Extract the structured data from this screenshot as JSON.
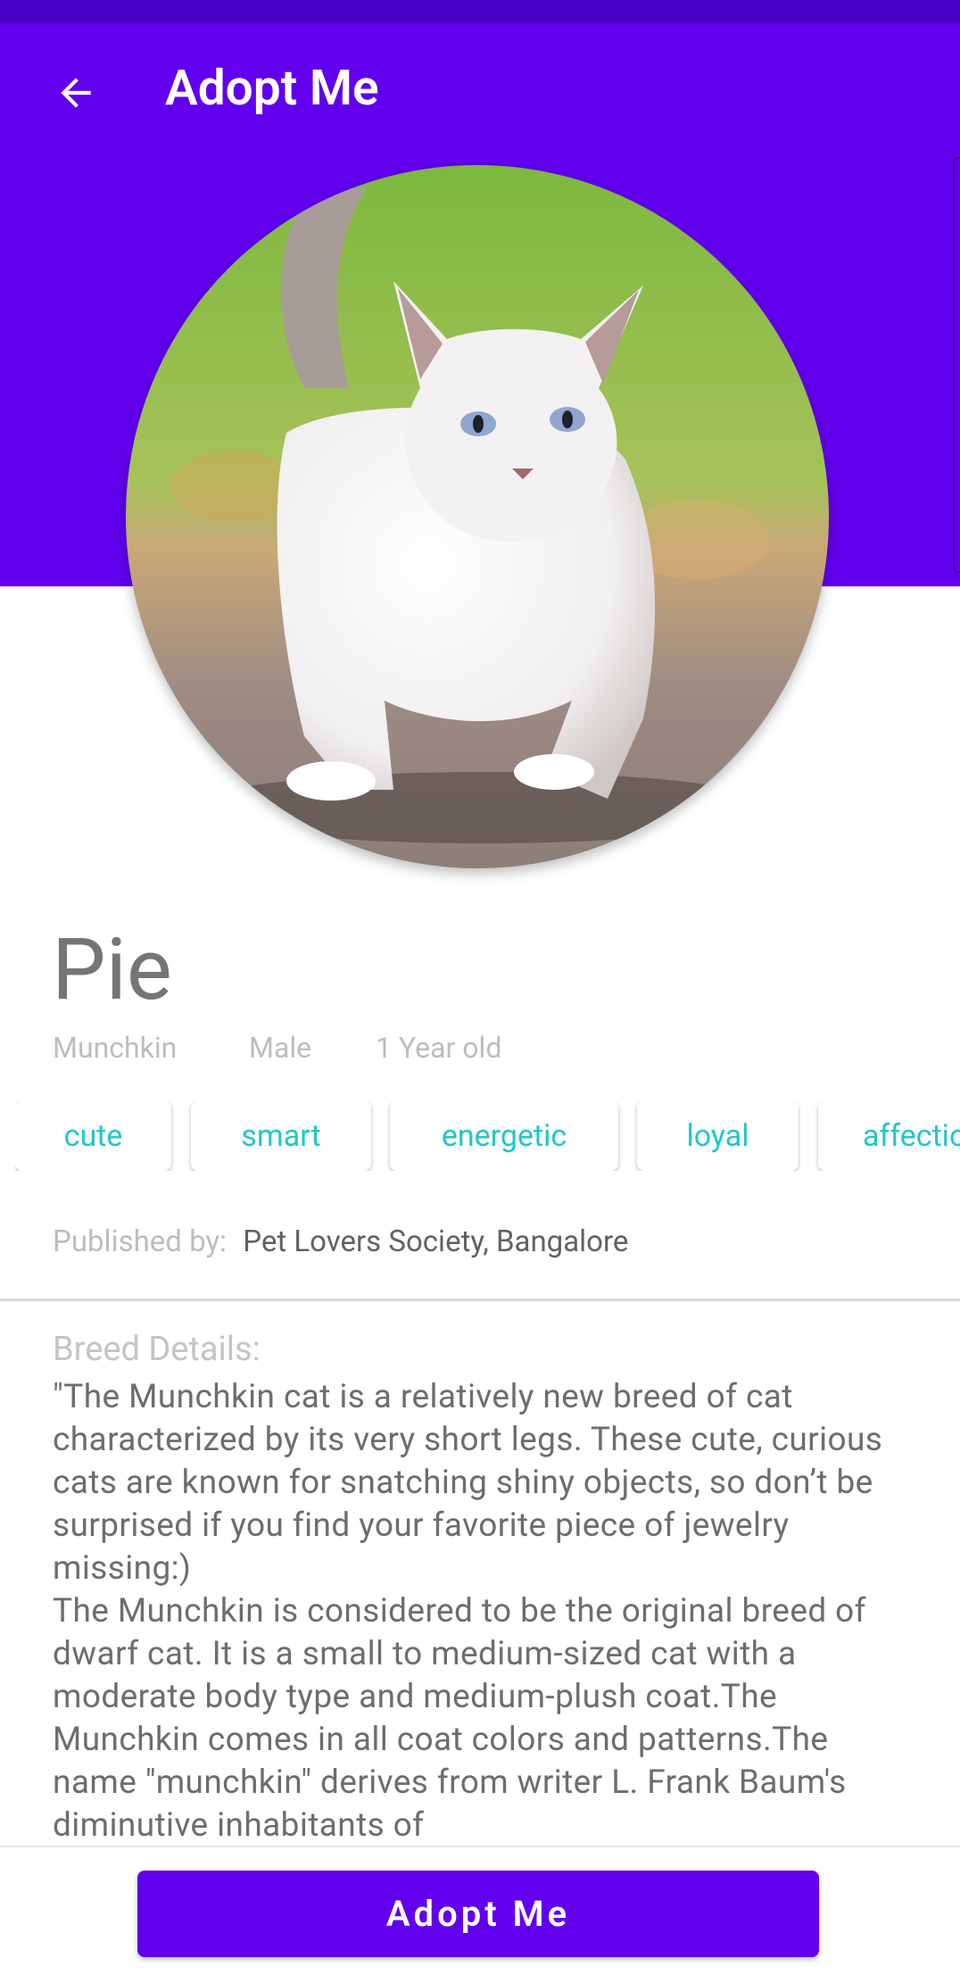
{
  "app": {
    "title": "Adopt Me",
    "accent_color": "#6200ee",
    "tag_color": "#24c6c6"
  },
  "pet": {
    "name": "Pie",
    "breed": "Munchkin",
    "gender": "Male",
    "age": "1 Year old",
    "photo": "white-munchkin-cat-walking"
  },
  "tags": [
    "cute",
    "smart",
    "energetic",
    "loyal",
    "affectionate"
  ],
  "published": {
    "label": "Published by:",
    "value": "Pet Lovers Society, Bangalore"
  },
  "breed_details": {
    "label": "Breed Details:",
    "text": "\"The Munchkin cat is a relatively new breed of cat characterized by its very short legs. These cute, curious cats are known for snatching shiny objects, so don’t be surprised if you find your favorite piece of jewelry missing:)\nThe Munchkin is considered to be the original breed of dwarf cat. It is a small to medium-sized cat with a moderate body type and medium-plush coat.The Munchkin comes in all coat colors and patterns.The name \"munchkin\" derives from writer L. Frank Baum's diminutive inhabitants of"
  },
  "actions": {
    "adopt_button": "Adopt Me"
  }
}
